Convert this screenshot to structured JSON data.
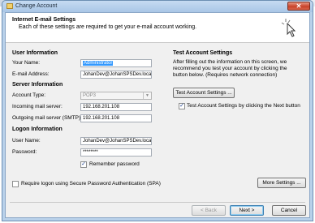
{
  "window": {
    "title": "Change Account",
    "close_glyph": "✕"
  },
  "header": {
    "title": "Internet E-mail Settings",
    "subtitle": "Each of these settings are required to get your e-mail account working.",
    "icon": "cursor-pointer-icon"
  },
  "user_information": {
    "heading": "User Information",
    "your_name_label": "Your Name:",
    "your_name_value": "Administrator",
    "email_label": "E-mail Address:",
    "email_value": "JohanDev@JohanSPSDev.loca"
  },
  "server_information": {
    "heading": "Server Information",
    "account_type_label": "Account Type:",
    "account_type_value": "POP3",
    "incoming_label": "Incoming mail server:",
    "incoming_value": "192.168.201.108",
    "outgoing_label": "Outgoing mail server (SMTP):",
    "outgoing_value": "192.168.201.108"
  },
  "logon_information": {
    "heading": "Logon Information",
    "user_name_label": "User Name:",
    "user_name_value": "JohanDev@JohanSPSDev.loca",
    "password_label": "Password:",
    "password_value": "********",
    "remember_label": "Remember password",
    "remember_checked": true,
    "spa_label": "Require logon using Secure Password Authentication (SPA)",
    "spa_checked": false
  },
  "test_settings": {
    "heading": "Test Account Settings",
    "description": "After filling out the information on this screen, we recommend you test your account by clicking the button below. (Requires network connection)",
    "test_button": "Test Account Settings ...",
    "auto_test_label": "Test Account Settings by clicking the Next button",
    "auto_test_checked": true
  },
  "buttons": {
    "more_settings": "More Settings ...",
    "back": "< Back",
    "next": "Next >",
    "cancel": "Cancel"
  },
  "checkmark": "✓",
  "dropdown_arrow": "▼"
}
